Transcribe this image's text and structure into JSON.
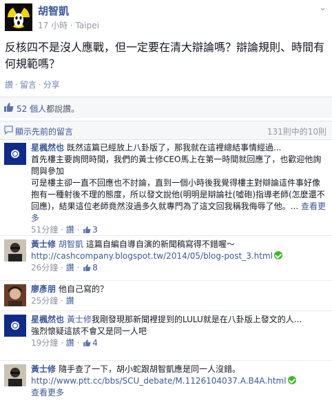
{
  "post": {
    "author": "胡智凱",
    "time": "17 小時",
    "location": "Taipei",
    "message": "反核四不是沒人應戰，但一定要在清大辯論嗎？辯論規則、時間有何規範嗎？",
    "actions": {
      "like": "讚",
      "comment": "留言",
      "share": "分享",
      "sep": "·"
    },
    "likes": {
      "count": "52 個人",
      "suffix": "都說讚。"
    },
    "previous": {
      "label": "顯示先前的留言",
      "count": "131則中的10則"
    }
  },
  "comments": [
    {
      "name": "星楓然也",
      "text_lines": [
        "既然這篇已經放上八卦版了，那我就在這裡總結事情經過...",
        "首先樓主要詢問時間，我們的黃士修CEO馬上在第一時間就回應了，也歡迎他詢問與參加",
        "可是樓主卻一直不回應也不討論，直到一個小時後我覺得樓主對辯論這件事好像抱有一種射後不理的態度，所以發文說他(明明是辯論社(噓砲)指導老師(怎麼還不回應)，結果這位老師竟然沒過多久就專門為了這文回我稱我侮辱了他。..."
      ],
      "more": "查看更多",
      "time": "51分鐘",
      "like_label": "讚",
      "likes": "3"
    },
    {
      "name": "黃士修",
      "tag": "胡智凱",
      "text": "這篇自編自導自演的新聞稿寫得不錯喔～",
      "link": "http://cashcompany.blogspot.tw/2014/05/blog-post_3.html",
      "time": "26分鐘",
      "like_label": "讚",
      "likes": "8"
    },
    {
      "name": "廖彥朋",
      "text": "他自己寫的？",
      "time": "25分鐘",
      "like_label": "讚"
    },
    {
      "name": "星楓然也",
      "tag": "黃士修",
      "text": "我剛發現那新聞裡提到的LULU就是在八卦版上發文的人...",
      "text2": "強烈懷疑這該不會又是同一人吧",
      "time": "19分鐘",
      "like_label": "讚",
      "likes": "4"
    },
    {
      "name": "黃士修",
      "text": "隨手查了一下，胡小蛇跟胡智凱應是同一人沒錯。",
      "link": "http://www.ptt.cc/bbs/SCU_debate/M.1126104037.A.B4A.html",
      "more": "查看更多"
    }
  ],
  "colors": {
    "link": "#3b5998",
    "muted": "#9197a3",
    "text": "#141823"
  }
}
